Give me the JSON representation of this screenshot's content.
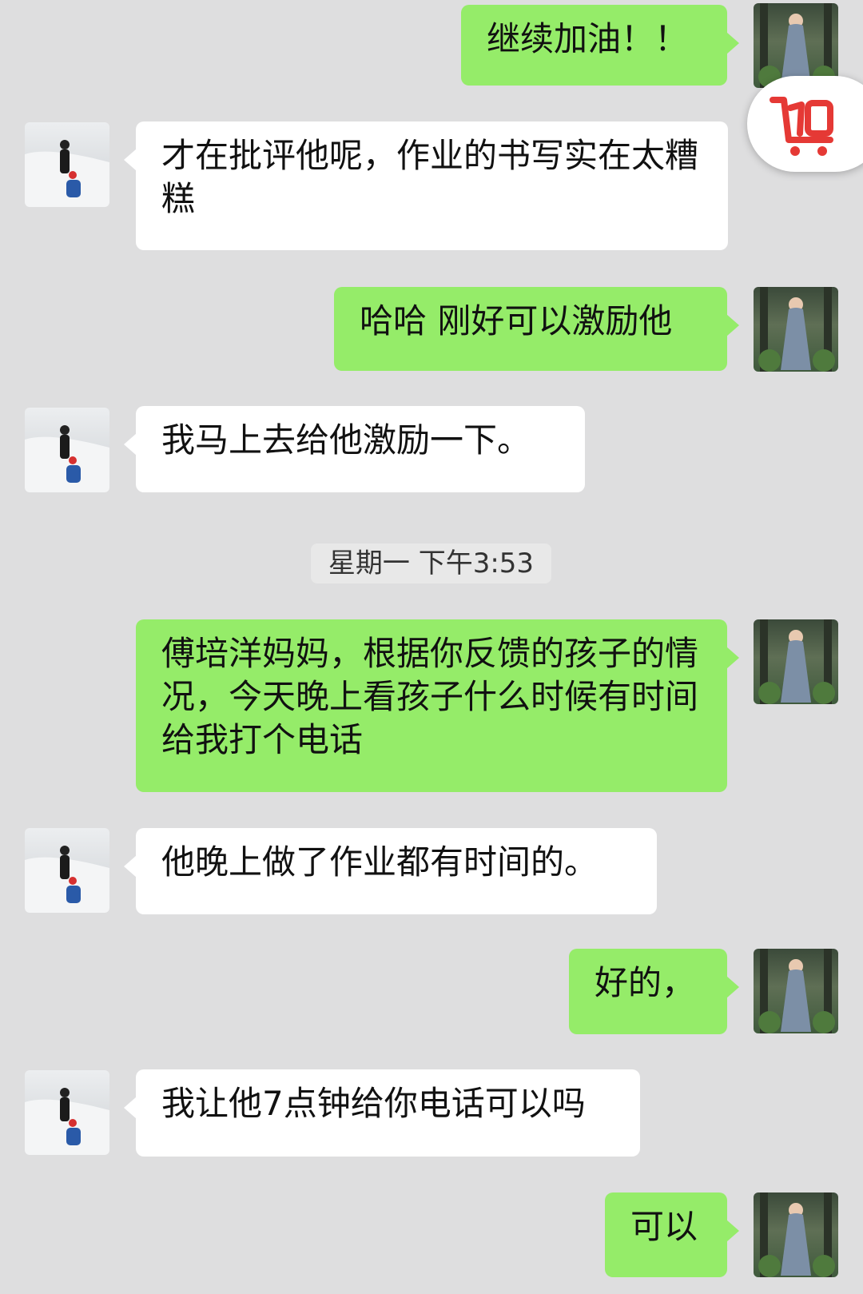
{
  "messages": [
    {
      "text": "继续加油！！"
    },
    {
      "text": "才在批评他呢，作业的书写实在太糟糕"
    },
    {
      "text": "哈哈  刚好可以激励他"
    },
    {
      "text": "我马上去给他激励一下。"
    },
    {
      "text": "傅培洋妈妈，根据你反馈的孩子的情况，今天晚上看孩子什么时候有时间给我打个电话"
    },
    {
      "text": "他晚上做了作业都有时间的。"
    },
    {
      "text": "好的，"
    },
    {
      "text": "我让他7点钟给你电话可以吗"
    },
    {
      "text": "可以"
    }
  ],
  "timestamp": "星期一 下午3:53",
  "floating_button": {
    "icon": "shopping-cart-icon",
    "color": "#e53935"
  },
  "colors": {
    "background": "#dededf",
    "outgoing_bubble": "#95ec69",
    "incoming_bubble": "#ffffff"
  }
}
